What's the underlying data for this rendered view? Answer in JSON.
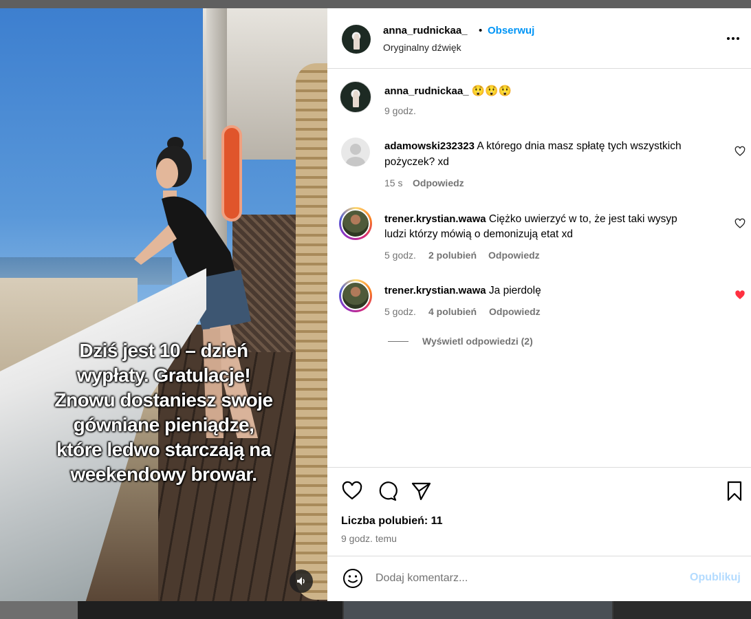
{
  "post": {
    "author": "anna_rudnickaa_",
    "dot": "•",
    "follow_label": "Obserwuj",
    "audio": "Oryginalny dźwięk",
    "caption_author": "anna_rudnickaa_",
    "caption_text": "😲😲😲",
    "caption_time": "9 godz.",
    "video_caption": "Dziś jest 10 – dzień\nwypłaty. Gratulacje!\nZnowu dostaniesz swoje\ngówniane pieniądze,\nktóre ledwo starczają na\nweekendowy browar."
  },
  "comments": [
    {
      "user": "adamowski232323",
      "line1": "A którego dnia masz spłatę tych wszystkich",
      "line2": "pożyczek? xd",
      "time": "15 s",
      "likes": "",
      "reply": "Odpowiedz",
      "liked": false
    },
    {
      "user": "trener.krystian.wawa",
      "line1": "Ciężko uwierzyć w to, że jest taki wysyp",
      "line2": "ludzi którzy mówią o demonizują etat xd",
      "time": "5 godz.",
      "likes": "2 polubień",
      "reply": "Odpowiedz",
      "liked": false
    },
    {
      "user": "trener.krystian.wawa",
      "line1": "Ja pierdolę",
      "line2": "",
      "time": "5 godz.",
      "likes": "4 polubień",
      "reply": "Odpowiedz",
      "liked": true
    }
  ],
  "view_replies": "Wyświetl odpowiedzi (2)",
  "stats": {
    "likes": "Liczba polubień: 11",
    "ago": "9 godz. temu"
  },
  "composer": {
    "placeholder": "Dodaj komentarz...",
    "publish": "Opublikuj"
  },
  "colors": {
    "link_blue": "#0095f6",
    "publish_disabled": "#b3dbff",
    "liked_red": "#ff3040",
    "secondary_text": "#737373"
  },
  "icons": [
    "more-icon",
    "heart-icon",
    "comment-icon",
    "share-icon",
    "bookmark-icon",
    "emoji-icon",
    "speaker-icon"
  ]
}
